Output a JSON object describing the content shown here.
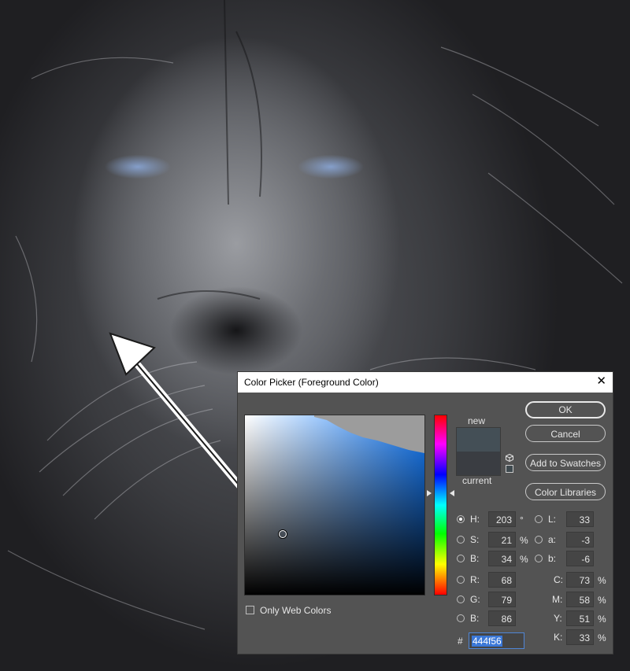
{
  "dialog": {
    "title": "Color Picker (Foreground Color)",
    "close_icon": "close-icon"
  },
  "preview": {
    "new_label": "new",
    "current_label": "current",
    "new_color": "#444f56",
    "current_color": "#3a3d42"
  },
  "buttons": {
    "ok": "OK",
    "cancel": "Cancel",
    "add_to_swatches": "Add to Swatches",
    "color_libraries": "Color Libraries"
  },
  "hsb": {
    "h_label": "H:",
    "h_value": "203",
    "h_unit": "°",
    "s_label": "S:",
    "s_value": "21",
    "s_unit": "%",
    "b_label": "B:",
    "b_value": "34",
    "b_unit": "%"
  },
  "rgb": {
    "r_label": "R:",
    "r_value": "68",
    "g_label": "G:",
    "g_value": "79",
    "b_label": "B:",
    "b_value": "86"
  },
  "lab": {
    "l_label": "L:",
    "l_value": "33",
    "a_label": "a:",
    "a_value": "-3",
    "b_label": "b:",
    "b_value": "-6"
  },
  "cmyk": {
    "c_label": "C:",
    "c_value": "73",
    "m_label": "M:",
    "m_value": "58",
    "y_label": "Y:",
    "y_value": "51",
    "k_label": "K:",
    "k_value": "33",
    "unit": "%"
  },
  "hex": {
    "hash": "#",
    "value": "444f56"
  },
  "only_web_colors": {
    "label": "Only Web Colors",
    "checked": false
  },
  "selected_mode": "H"
}
